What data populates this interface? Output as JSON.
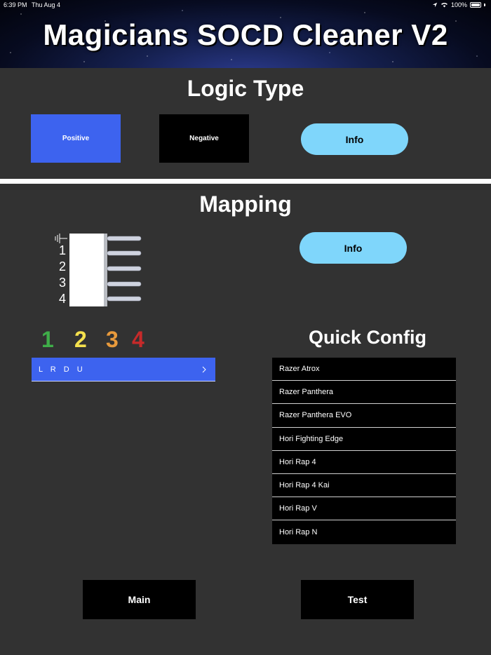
{
  "status_bar": {
    "time": "6:39 PM",
    "date": "Thu Aug 4",
    "battery": "100%"
  },
  "banner": {
    "title": "Magicians SOCD Cleaner V2"
  },
  "logic_type": {
    "title": "Logic Type",
    "positive_label": "Positive",
    "negative_label": "Negative",
    "info_label": "Info",
    "selected": "Positive"
  },
  "mapping": {
    "title": "Mapping",
    "info_label": "Info",
    "connector_pins": [
      "1",
      "2",
      "3",
      "4"
    ],
    "pin_colors": [
      {
        "label": "1",
        "color": "#3fae49"
      },
      {
        "label": "2",
        "color": "#f4e04d"
      },
      {
        "label": "3",
        "color": "#e89a3c"
      },
      {
        "label": "4",
        "color": "#c62a2a"
      }
    ],
    "selected_mapping": "L R D U"
  },
  "quick_config": {
    "title": "Quick Config",
    "items": [
      "Razer Atrox",
      "Razer Panthera",
      "Razer Panthera EVO",
      "Hori Fighting Edge",
      "Hori Rap 4",
      "Hori Rap 4 Kai",
      "Hori Rap V",
      "Hori Rap N"
    ]
  },
  "bottom_nav": {
    "main_label": "Main",
    "test_label": "Test"
  },
  "colors": {
    "background": "#323232",
    "accent_blue": "#3d63ef",
    "info_button": "#7fd6fb"
  }
}
